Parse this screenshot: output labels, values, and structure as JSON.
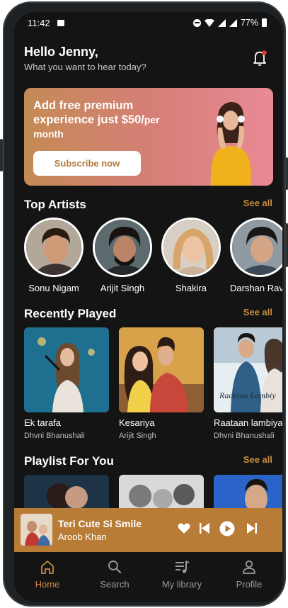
{
  "status_bar": {
    "time": "11:42",
    "battery": "77%"
  },
  "greeting": {
    "title": "Hello Jenny,",
    "subtitle": "What you want to hear today?"
  },
  "banner": {
    "line1": "Add free premium",
    "line2_main": "experience just $50/",
    "line2_small": "per",
    "line3": "month",
    "button": "Subscribe now"
  },
  "top_artists": {
    "title": "Top Artists",
    "see_all": "See all",
    "items": [
      {
        "name": "Sonu Nigam"
      },
      {
        "name": "Arijit Singh"
      },
      {
        "name": "Shakira"
      },
      {
        "name": "Darshan Raval"
      }
    ]
  },
  "recently_played": {
    "title": "Recently Played",
    "see_all": "See all",
    "items": [
      {
        "title": "Ek tarafa",
        "artist": "Dhvni Bhanushali"
      },
      {
        "title": "Kesariya",
        "artist": "Arijit Singh"
      },
      {
        "title": "Raataan lambiyan",
        "artist": "Dhvni Bhanushali",
        "art_text": "Raataan Lambiy"
      }
    ]
  },
  "playlist": {
    "title": "Playlist For You",
    "see_all": "See all"
  },
  "now_playing": {
    "song": "Teri Cute Si Smile",
    "artist": "Aroob Khan"
  },
  "nav": {
    "items": [
      {
        "label": "Home",
        "active": true
      },
      {
        "label": "Search"
      },
      {
        "label": "My library"
      },
      {
        "label": "Profile"
      }
    ]
  },
  "colors": {
    "accent": "#c98d3f",
    "player_bg": "#b97c37",
    "background": "#141414"
  }
}
